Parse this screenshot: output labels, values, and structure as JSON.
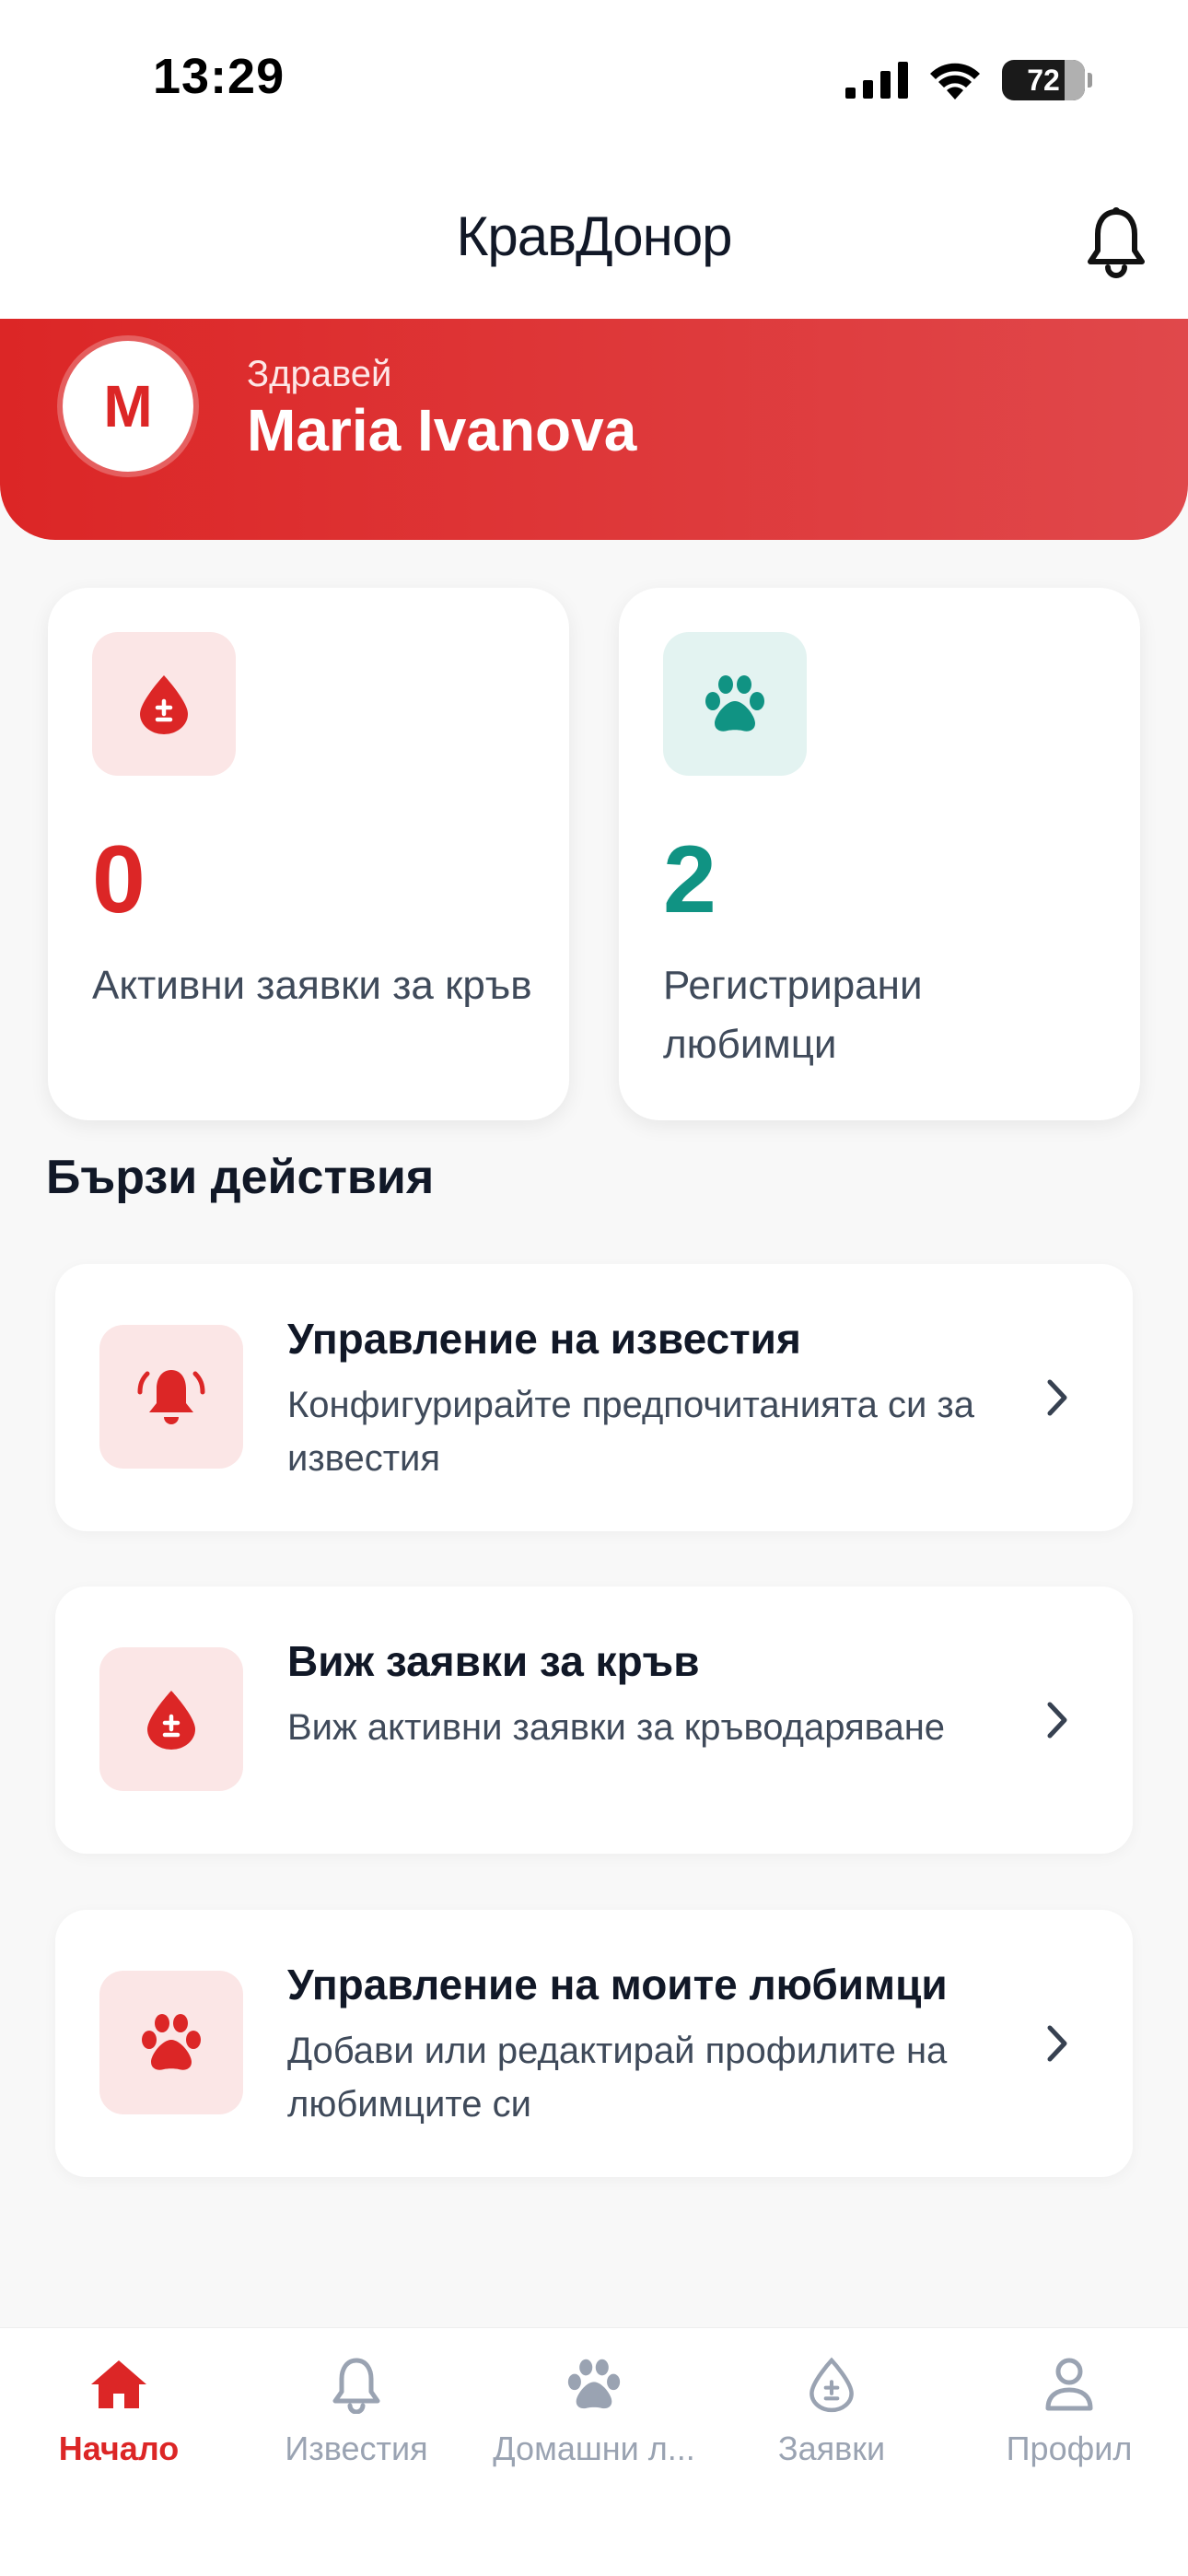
{
  "status_bar": {
    "time": "13:29",
    "battery": "72"
  },
  "header": {
    "title": "КравДонор"
  },
  "user": {
    "initial": "M",
    "greeting": "Здравей",
    "name": "Maria Ivanova"
  },
  "stats": [
    {
      "value": "0",
      "label": "Активни заявки за кръв",
      "icon": "blood-drop-icon",
      "color": "#dc2626"
    },
    {
      "value": "2",
      "label": "Регистрирани любимци",
      "icon": "paw-icon",
      "color": "#109383"
    }
  ],
  "quick_actions": {
    "title": "Бързи действия",
    "items": [
      {
        "title": "Управление на известия",
        "description": "Конфигурирайте предпочитанията си за известия",
        "icon": "bell-ringing-icon"
      },
      {
        "title": "Виж заявки за кръв",
        "description": "Виж активни заявки за кръводаряване",
        "icon": "blood-drop-icon"
      },
      {
        "title": "Управление на моите любимци",
        "description": "Добави или редактирай профилите на любимците си",
        "icon": "paw-icon"
      }
    ]
  },
  "bottom_nav": [
    {
      "label": "Начало",
      "icon": "home-icon",
      "active": true
    },
    {
      "label": "Известия",
      "icon": "bell-icon",
      "active": false
    },
    {
      "label": "Домашни л...",
      "icon": "paw-icon",
      "active": false
    },
    {
      "label": "Заявки",
      "icon": "blood-drop-icon",
      "active": false
    },
    {
      "label": "Профил",
      "icon": "user-icon",
      "active": false
    }
  ],
  "colors": {
    "primary": "#dc2626",
    "teal": "#109383",
    "inactive": "#9aa3b2"
  }
}
